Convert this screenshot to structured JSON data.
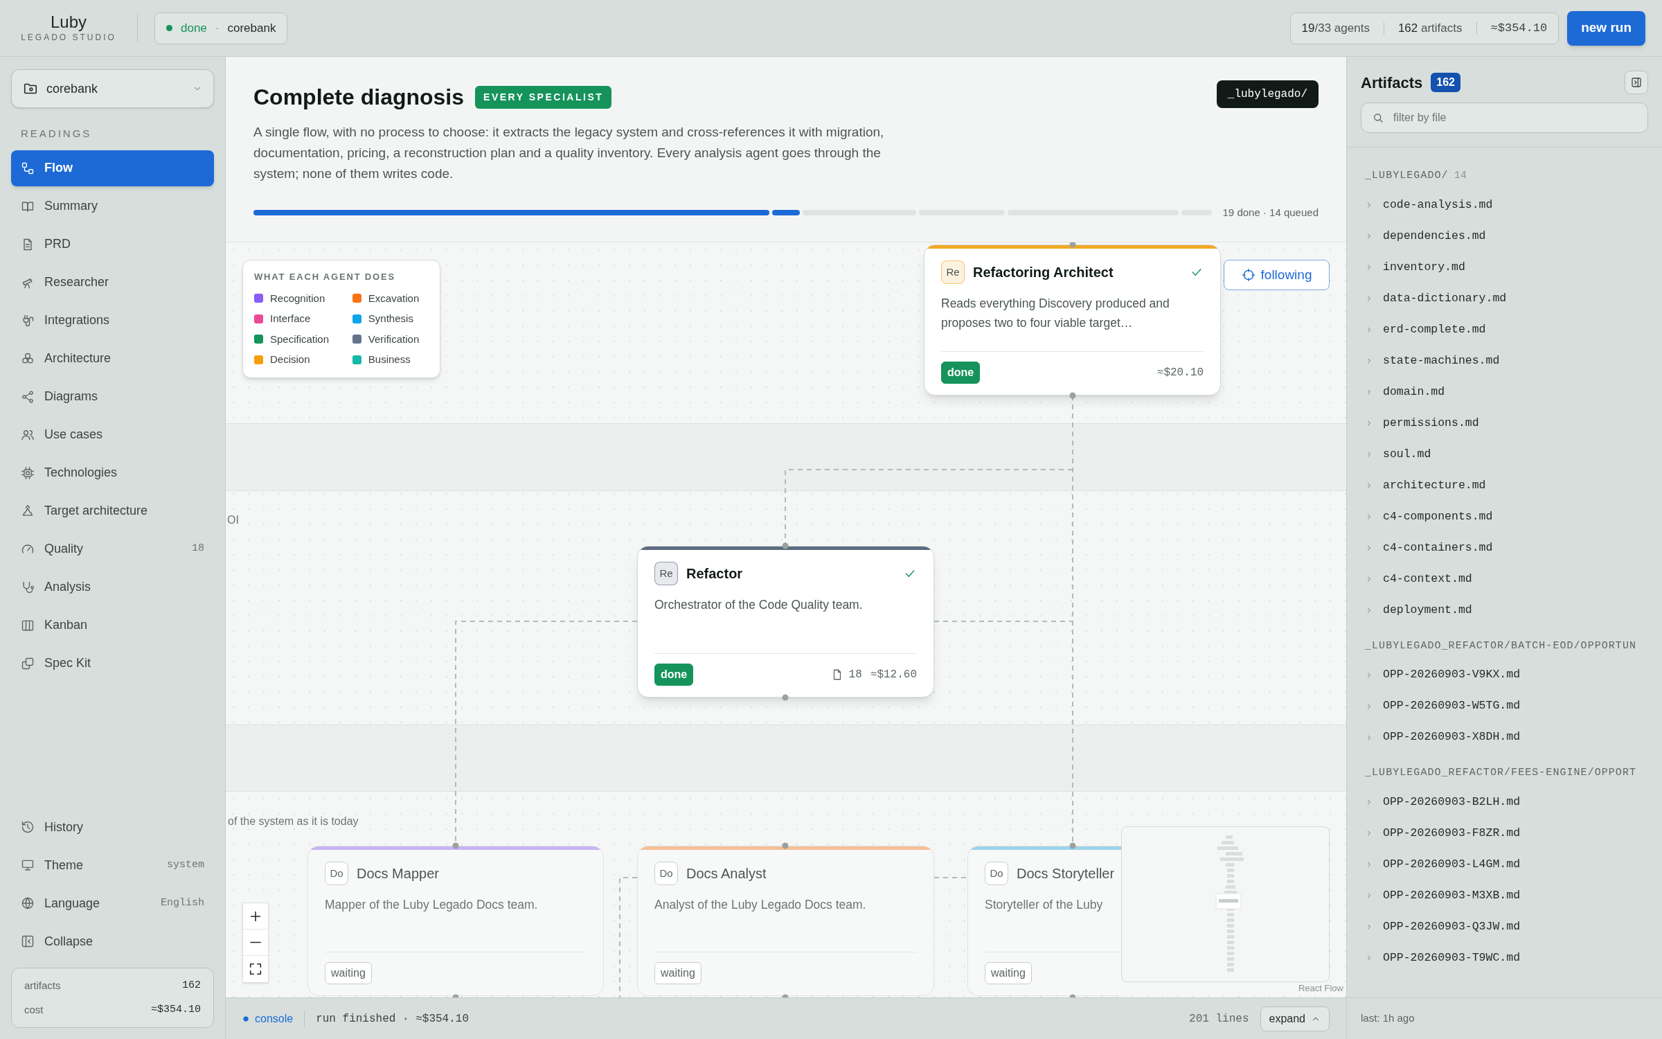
{
  "brand": {
    "name": "Luby",
    "subtitle": "LEGADO STUDIO"
  },
  "run_chip": {
    "status": "done",
    "separator": "·",
    "project": "corebank"
  },
  "stats": [
    {
      "kind": "text",
      "text": "**19**/33 agents"
    },
    {
      "kind": "text",
      "text": "**162** artifacts"
    },
    {
      "kind": "mono",
      "text": "≈$354.10"
    }
  ],
  "new_run_button": "new run",
  "sidebar": {
    "project_select": "corebank",
    "section_label": "READINGS",
    "items": [
      {
        "label": "Flow",
        "selected": true
      },
      {
        "label": "Summary",
        "selected": false
      },
      {
        "label": "PRD",
        "selected": false
      },
      {
        "label": "Researcher",
        "selected": false
      },
      {
        "label": "Integrations",
        "selected": false
      },
      {
        "label": "Architecture",
        "selected": false
      },
      {
        "label": "Diagrams",
        "selected": false
      },
      {
        "label": "Use cases",
        "selected": false
      },
      {
        "label": "Technologies",
        "selected": false
      },
      {
        "label": "Target architecture",
        "selected": false
      },
      {
        "label": "Quality",
        "selected": false,
        "count": "18"
      },
      {
        "label": "Analysis",
        "selected": false
      },
      {
        "label": "Kanban",
        "selected": false
      },
      {
        "label": "Spec Kit",
        "selected": false
      }
    ],
    "footer_items": [
      {
        "label": "History"
      },
      {
        "label": "Theme",
        "value": "system"
      },
      {
        "label": "Language",
        "value": "English"
      },
      {
        "label": "Collapse"
      }
    ],
    "totals": [
      {
        "label": "artifacts",
        "value": "162"
      },
      {
        "label": "cost",
        "value": "≈$354.10"
      }
    ]
  },
  "header": {
    "title": "Complete diagnosis",
    "badge": "EVERY SPECIALIST",
    "path_chip": "_lubylegado/",
    "description": "A single flow, with no process to choose: it extracts the legacy system and cross-references it with migration, documentation, pricing, a reconstruction plan and a quality inventory. Every analysis agent goes through the system; none of them writes code.",
    "progress": {
      "segments": [
        {
          "done": true
        },
        {
          "done": true
        },
        {
          "done": false
        },
        {
          "done": false
        },
        {
          "done": false
        },
        {
          "done": false
        }
      ],
      "summary": "19 done · 14 queued"
    }
  },
  "canvas": {
    "legend": {
      "title": "WHAT EACH AGENT DOES",
      "items": [
        {
          "label": "Recognition",
          "color": "#8b5cf6"
        },
        {
          "label": "Interface",
          "color": "#ec4899"
        },
        {
          "label": "Specification",
          "color": "#15935b"
        },
        {
          "label": "Decision",
          "color": "#f59e0b"
        },
        {
          "label": "Excavation",
          "color": "#f97316"
        },
        {
          "label": "Synthesis",
          "color": "#0ea5e9"
        },
        {
          "label": "Verification",
          "color": "#64748b"
        },
        {
          "label": "Business",
          "color": "#14b8a6"
        }
      ]
    },
    "lane_labels": [
      "OI",
      "of the system as it is today"
    ],
    "follow_button": "following",
    "nodes": [
      {
        "abbr": "Re",
        "name": "Refactoring Architect",
        "description": "Reads everything Discovery produced and proposes two to four viable target…",
        "status": "done",
        "checked": true,
        "cost": "≈$20.10",
        "color": "#f2a825"
      },
      {
        "abbr": "Re",
        "name": "Refactor",
        "description": "Orchestrator of the Code Quality team.",
        "status": "done",
        "checked": true,
        "files": "18",
        "cost": "≈$12.60",
        "color": "#5b6b80"
      },
      {
        "abbr": "Do",
        "name": "Docs Mapper",
        "description": "Mapper of the Luby Legado Docs team.",
        "status": "waiting",
        "checked": false,
        "color": "#c9b3f5"
      },
      {
        "abbr": "Do",
        "name": "Docs Analyst",
        "description": "Analyst of the Luby Legado Docs team.",
        "status": "waiting",
        "checked": false,
        "color": "#f5bf97"
      },
      {
        "abbr": "Do",
        "name": "Docs Storyteller",
        "description": "Storyteller of the Luby",
        "status": "waiting",
        "checked": false,
        "color": "#9dd3ea"
      }
    ],
    "attribution": "React Flow"
  },
  "console": {
    "label": "console",
    "message": "run finished · ≈$354.10",
    "lines": "201 lines",
    "expand_button": "expand"
  },
  "artifacts": {
    "title": "Artifacts",
    "count": "162",
    "search_placeholder": "filter by file",
    "groups": [
      {
        "label": "_LUBYLEGADO/",
        "count": "14",
        "files": [
          "code-analysis.md",
          "dependencies.md",
          "inventory.md",
          "data-dictionary.md",
          "erd-complete.md",
          "state-machines.md",
          "domain.md",
          "permissions.md",
          "soul.md",
          "architecture.md",
          "c4-components.md",
          "c4-containers.md",
          "c4-context.md",
          "deployment.md"
        ]
      },
      {
        "label": "_LUBYLEGADO_REFACTOR/BATCH-EOD/OPPORTUN",
        "files": [
          "OPP-20260903-V9KX.md",
          "OPP-20260903-W5TG.md",
          "OPP-20260903-X8DH.md"
        ]
      },
      {
        "label": "_LUBYLEGADO_REFACTOR/FEES-ENGINE/OPPORT",
        "files": [
          "OPP-20260903-B2LH.md",
          "OPP-20260903-F8ZR.md",
          "OPP-20260903-L4GM.md",
          "OPP-20260903-M3XB.md",
          "OPP-20260903-Q3JW.md",
          "OPP-20260903-T9WC.md"
        ]
      }
    ],
    "footer": "last: 1h ago"
  }
}
